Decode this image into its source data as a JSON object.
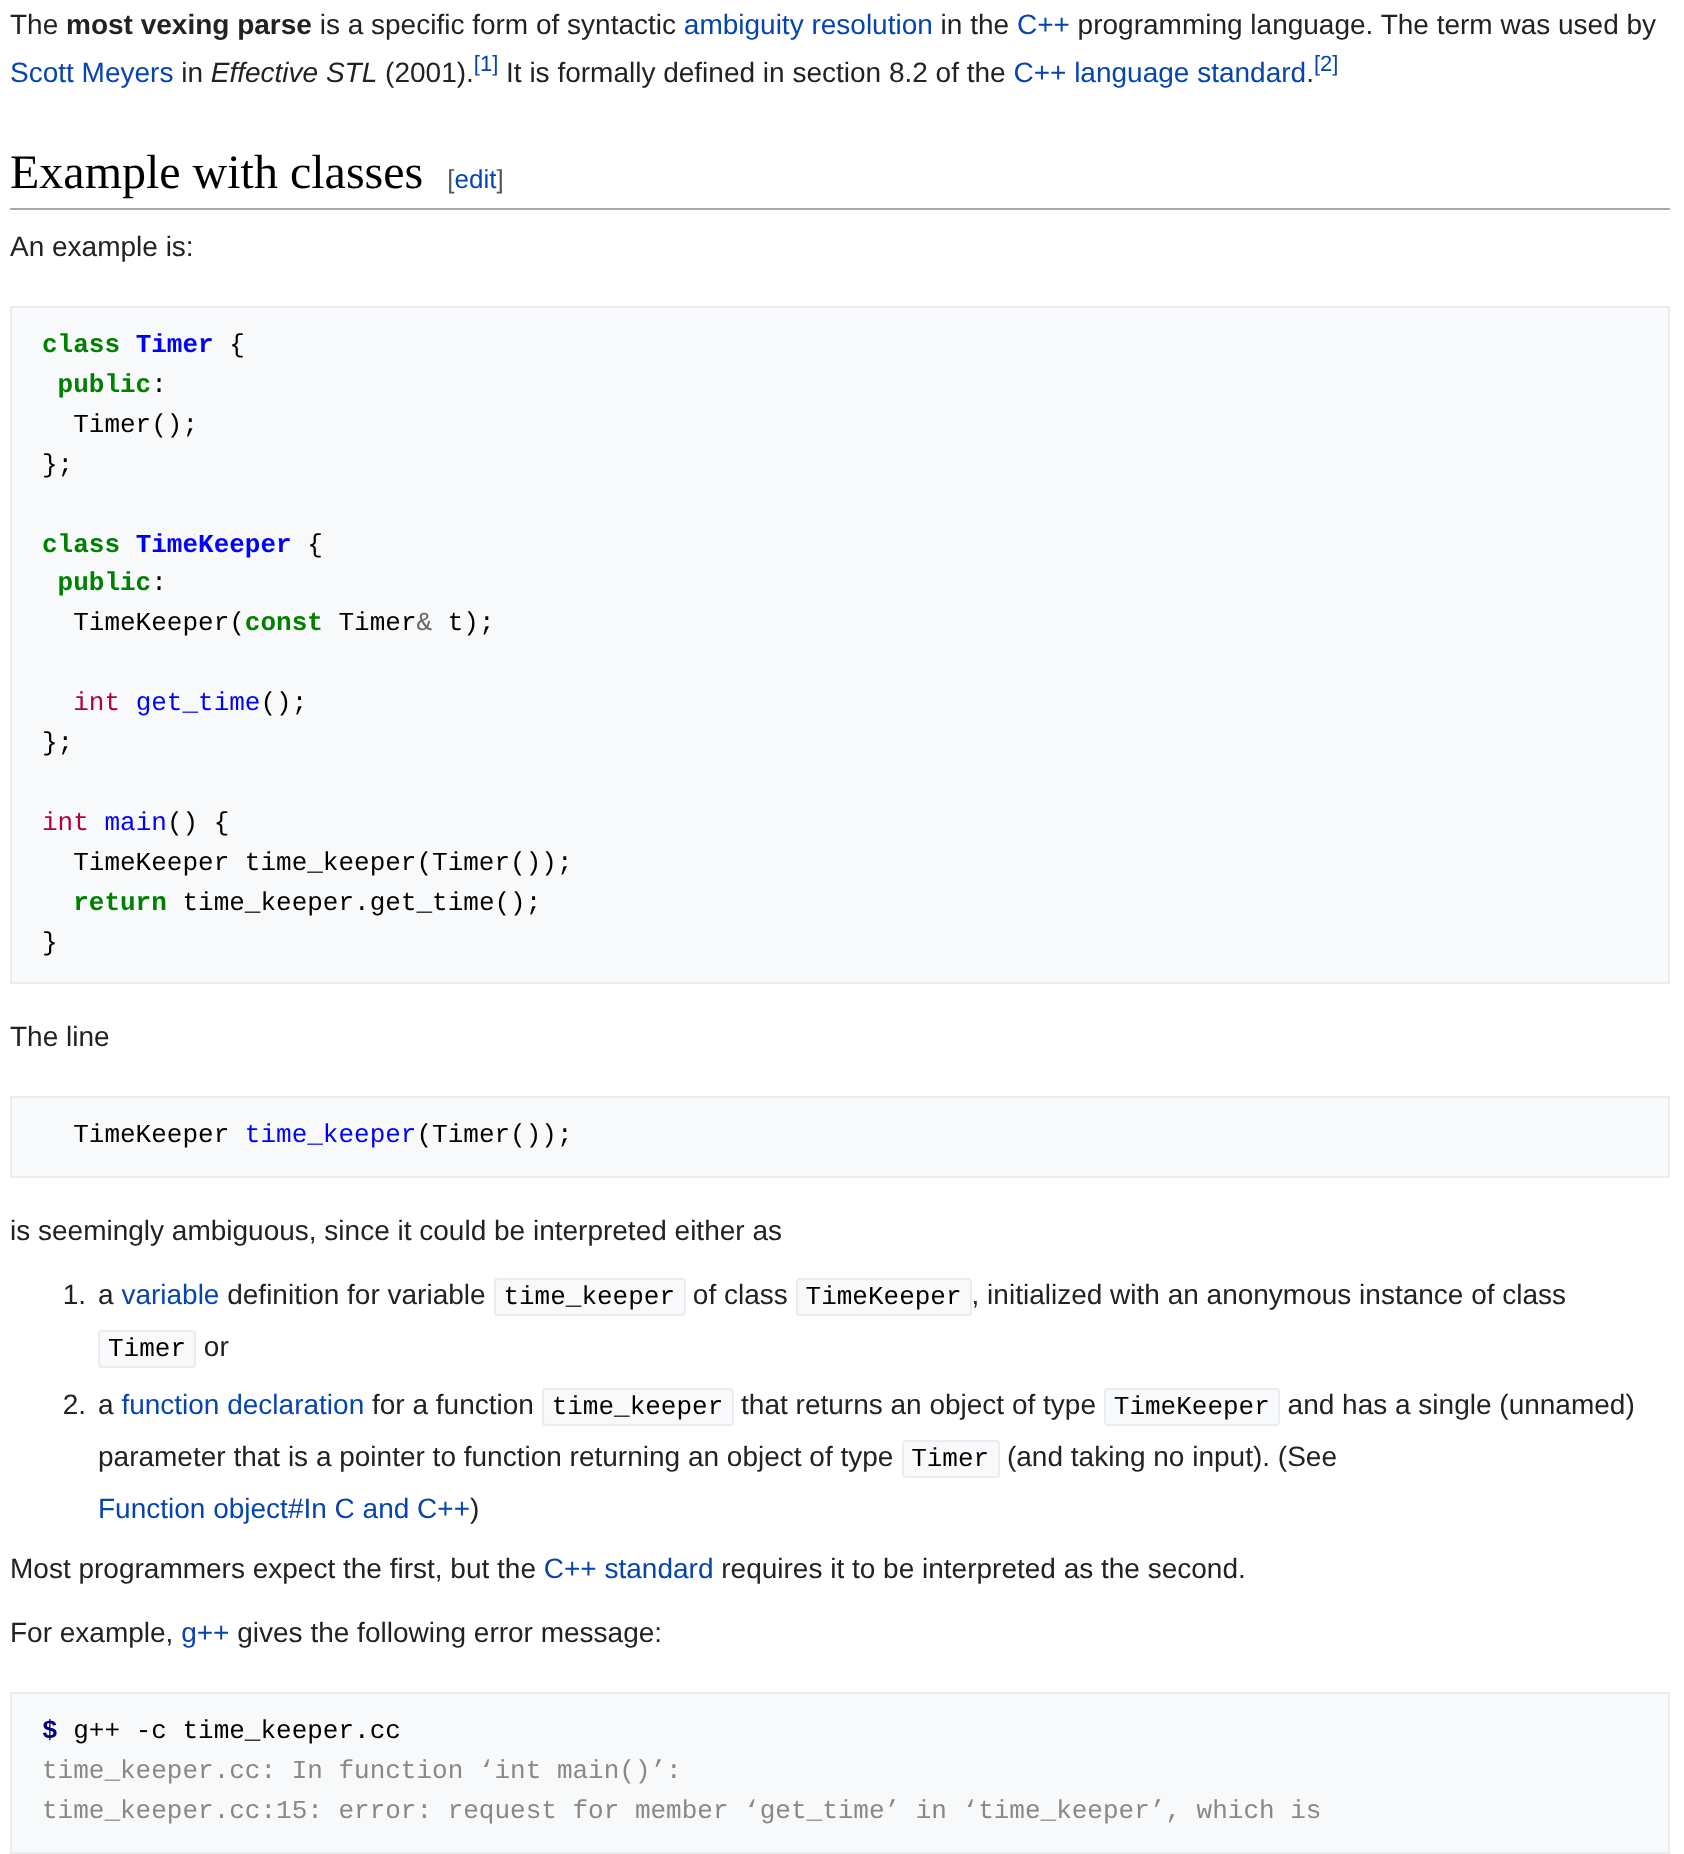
{
  "article": [
    {
      "kind": "paragraph",
      "segments": [
        {
          "kind": "text",
          "text": "The **most vexing parse** is a specific form of syntactic "
        },
        {
          "kind": "link",
          "text": "ambiguity resolution"
        },
        {
          "kind": "text",
          "text": " in the "
        },
        {
          "kind": "link",
          "text": "C++"
        },
        {
          "kind": "text",
          "text": " programming language. The term was used by "
        },
        {
          "kind": "link",
          "text": "Scott Meyers"
        },
        {
          "kind": "text",
          "text": " in *Effective STL* (2001)."
        },
        {
          "kind": "ref",
          "text": "[1]"
        },
        {
          "kind": "text",
          "text": " It is formally defined in section 8.2 of the "
        },
        {
          "kind": "link",
          "text": "C++ language standard"
        },
        {
          "kind": "text",
          "text": "."
        },
        {
          "kind": "ref",
          "text": "[2]"
        }
      ]
    },
    {
      "kind": "heading",
      "title": "Example with classes",
      "edit_open": "[",
      "edit_link": "edit",
      "edit_close": "]"
    },
    {
      "kind": "paragraph",
      "segments": [
        {
          "kind": "text",
          "text": "An example is:"
        }
      ]
    },
    {
      "kind": "code",
      "groups": [
        {
          "lines": [
            [
              {
                "kind": "keyword",
                "text": "class "
              },
              {
                "kind": "type",
                "text": "Timer"
              },
              {
                "kind": "plain",
                "text": " {"
              }
            ],
            [
              {
                "kind": "keyword",
                "text": " public"
              },
              {
                "kind": "plain",
                "text": ":"
              }
            ],
            [
              {
                "kind": "plain",
                "text": "  Timer();"
              }
            ],
            [
              {
                "kind": "plain",
                "text": "};"
              }
            ]
          ]
        },
        {
          "lines": [
            [
              {
                "kind": "keyword",
                "text": "class "
              },
              {
                "kind": "type",
                "text": "TimeKeeper"
              },
              {
                "kind": "plain",
                "text": " {"
              }
            ],
            [
              {
                "kind": "keyword",
                "text": " public"
              },
              {
                "kind": "plain",
                "text": ":"
              }
            ],
            [
              {
                "kind": "plain",
                "text": "  TimeKeeper("
              },
              {
                "kind": "keyword",
                "text": "const"
              },
              {
                "kind": "plain",
                "text": " Timer"
              },
              {
                "kind": "operator",
                "text": "&"
              },
              {
                "kind": "plain",
                "text": " t);"
              }
            ]
          ]
        },
        {
          "lines": [
            [
              {
                "kind": "builtin",
                "text": "  int "
              },
              {
                "kind": "name",
                "text": "get_time"
              },
              {
                "kind": "plain",
                "text": "();"
              }
            ],
            [
              {
                "kind": "plain",
                "text": "};"
              }
            ]
          ]
        },
        {
          "lines": [
            [
              {
                "kind": "builtin",
                "text": "int "
              },
              {
                "kind": "name",
                "text": "main"
              },
              {
                "kind": "plain",
                "text": "() {"
              }
            ],
            [
              {
                "kind": "plain",
                "text": "  TimeKeeper time_keeper(Timer());"
              }
            ],
            [
              {
                "kind": "keyword",
                "text": "  return"
              },
              {
                "kind": "plain",
                "text": " time_keeper.get_time();"
              }
            ],
            [
              {
                "kind": "plain",
                "text": "}"
              }
            ]
          ]
        }
      ]
    },
    {
      "kind": "paragraph",
      "segments": [
        {
          "kind": "text",
          "text": "The line"
        }
      ]
    },
    {
      "kind": "code",
      "groups": [
        {
          "lines": [
            [
              {
                "kind": "plain",
                "text": "  TimeKeeper "
              },
              {
                "kind": "name",
                "text": "time_keeper"
              },
              {
                "kind": "plain",
                "text": "(Timer());"
              }
            ]
          ]
        }
      ]
    },
    {
      "kind": "paragraph",
      "segments": [
        {
          "kind": "text",
          "text": "is seemingly ambiguous, since it could be interpreted either as"
        }
      ]
    },
    {
      "kind": "list",
      "items": [
        {
          "number": "1.",
          "segments": [
            {
              "kind": "text",
              "text": "a "
            },
            {
              "kind": "link",
              "text": "variable"
            },
            {
              "kind": "text",
              "text": " definition for variable "
            },
            {
              "kind": "code",
              "text": "time_keeper"
            },
            {
              "kind": "text",
              "text": " of class "
            },
            {
              "kind": "code",
              "text": "TimeKeeper"
            },
            {
              "kind": "text",
              "text": ", initialized with an anonymous instance of class "
            },
            {
              "kind": "code",
              "text": "Timer"
            },
            {
              "kind": "text",
              "text": " or"
            }
          ]
        },
        {
          "number": "2.",
          "segments": [
            {
              "kind": "text",
              "text": "a "
            },
            {
              "kind": "link",
              "text": "function declaration"
            },
            {
              "kind": "text",
              "text": " for a function "
            },
            {
              "kind": "code",
              "text": "time_keeper"
            },
            {
              "kind": "text",
              "text": " that returns an object of type "
            },
            {
              "kind": "code",
              "text": "TimeKeeper"
            },
            {
              "kind": "text",
              "text": " and has a single (unnamed) parameter that is a pointer to function returning an object of type "
            },
            {
              "kind": "code",
              "text": "Timer"
            },
            {
              "kind": "text",
              "text": " (and taking no input). (See "
            },
            {
              "kind": "link",
              "text": "Function object#In C and C++"
            },
            {
              "kind": "text",
              "text": ")"
            }
          ]
        }
      ]
    },
    {
      "kind": "paragraph",
      "segments": [
        {
          "kind": "text",
          "text": "Most programmers expect the first, but the "
        },
        {
          "kind": "link",
          "text": "C++ standard"
        },
        {
          "kind": "text",
          "text": " requires it to be interpreted as the second."
        }
      ]
    },
    {
      "kind": "paragraph",
      "segments": [
        {
          "kind": "text",
          "text": "For example, "
        },
        {
          "kind": "link",
          "text": "g++"
        },
        {
          "kind": "text",
          "text": " gives the following error message:"
        }
      ]
    },
    {
      "kind": "code",
      "groups": [
        {
          "lines": [
            [
              {
                "kind": "prompt",
                "text": "$"
              },
              {
                "kind": "plain",
                "text": " g++ -c time_keeper.cc"
              }
            ],
            [
              {
                "kind": "output",
                "text": "time_keeper.cc: In function ‘int main()’:"
              }
            ],
            [
              {
                "kind": "output",
                "text": "time_keeper.cc:15: error: request for member ‘get_time’ in ‘time_keeper’, which is"
              }
            ]
          ]
        }
      ]
    }
  ]
}
